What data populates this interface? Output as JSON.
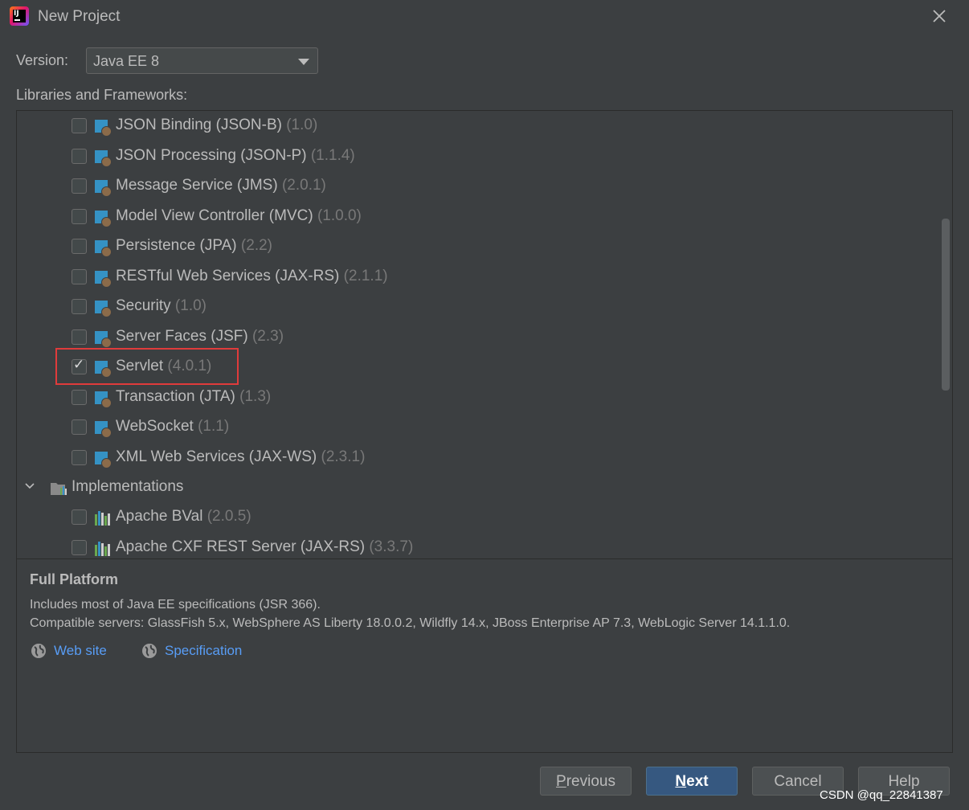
{
  "window": {
    "title": "New Project"
  },
  "version": {
    "label": "Version:",
    "value": "Java EE 8"
  },
  "libraries_label": "Libraries and Frameworks:",
  "libraries": [
    {
      "name": "JSON Binding (JSON-B)",
      "version": "(1.0)",
      "checked": false
    },
    {
      "name": "JSON Processing (JSON-P)",
      "version": "(1.1.4)",
      "checked": false
    },
    {
      "name": "Message Service (JMS)",
      "version": "(2.0.1)",
      "checked": false
    },
    {
      "name": "Model View Controller (MVC)",
      "version": "(1.0.0)",
      "checked": false
    },
    {
      "name": "Persistence (JPA)",
      "version": "(2.2)",
      "checked": false
    },
    {
      "name": "RESTful Web Services (JAX-RS)",
      "version": "(2.1.1)",
      "checked": false
    },
    {
      "name": "Security",
      "version": "(1.0)",
      "checked": false
    },
    {
      "name": "Server Faces (JSF)",
      "version": "(2.3)",
      "checked": false
    },
    {
      "name": "Servlet",
      "version": "(4.0.1)",
      "checked": true
    },
    {
      "name": "Transaction (JTA)",
      "version": "(1.3)",
      "checked": false
    },
    {
      "name": "WebSocket",
      "version": "(1.1)",
      "checked": false
    },
    {
      "name": "XML Web Services (JAX-WS)",
      "version": "(2.3.1)",
      "checked": false
    }
  ],
  "implementations": {
    "label": "Implementations",
    "items": [
      {
        "name": "Apache BVal",
        "version": "(2.0.5)",
        "checked": false
      },
      {
        "name": "Apache CXF REST Server (JAX-RS)",
        "version": "(3.3.7)",
        "checked": false
      }
    ]
  },
  "description": {
    "title": "Full Platform",
    "line1": "Includes most of Java EE specifications (JSR 366).",
    "line2": "Compatible servers: GlassFish 5.x, WebSphere AS Liberty 18.0.0.2, Wildfly 14.x, JBoss Enterprise AP 7.3, WebLogic Server 14.1.1.0.",
    "links": {
      "website": "Web site",
      "specification": "Specification"
    }
  },
  "buttons": {
    "previous_first": "P",
    "previous_rest": "revious",
    "next_first": "N",
    "next_rest": "ext",
    "cancel": "Cancel",
    "help": "Help"
  },
  "watermark": "CSDN @qq_22841387",
  "colors": {
    "highlight_box": "#e03b3b",
    "link": "#589df6",
    "default_button": "#365880"
  }
}
